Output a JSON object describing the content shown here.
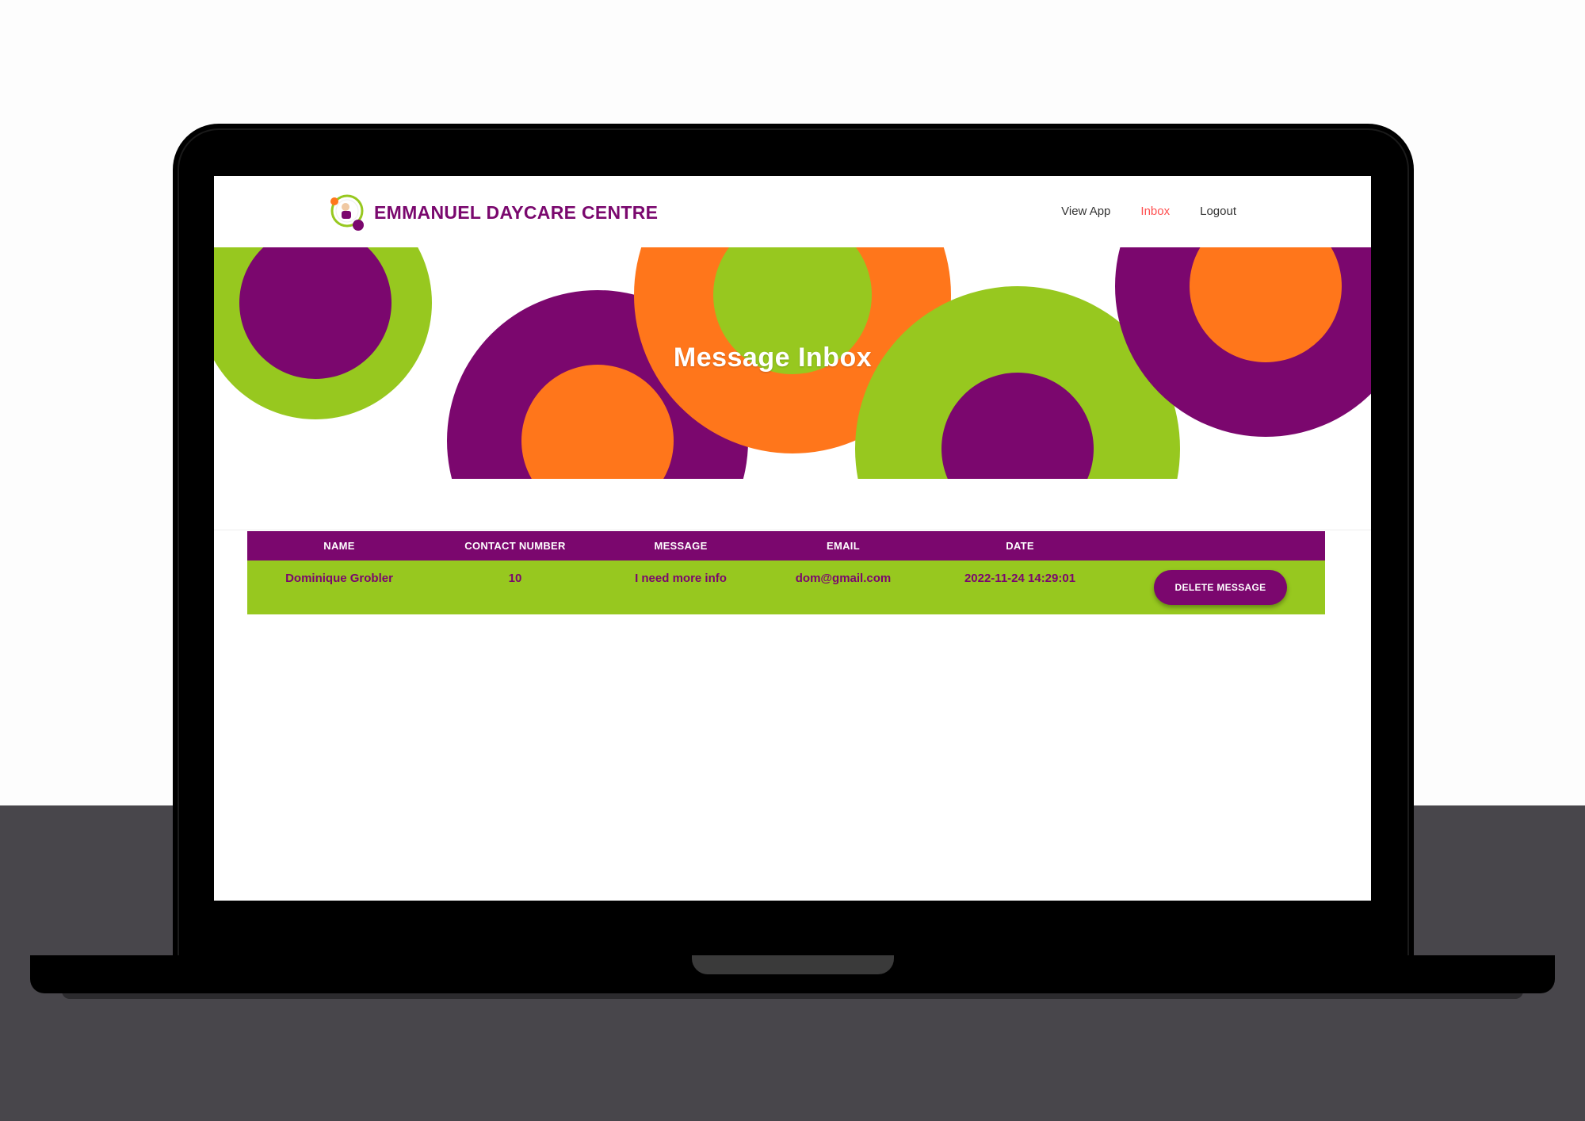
{
  "brand": {
    "name": "EMMANUEL DAYCARE CENTRE"
  },
  "nav": {
    "items": [
      "View App",
      "Inbox",
      "Logout"
    ],
    "active": "Inbox"
  },
  "hero": {
    "title": "Message Inbox"
  },
  "table": {
    "columns": [
      "NAME",
      "CONTACT NUMBER",
      "MESSAGE",
      "EMAIL",
      "DATE",
      ""
    ],
    "rows": [
      {
        "name": "Dominique Grobler",
        "contact": "10",
        "message": "I need more info",
        "email": "dom@gmail.com",
        "date": "2022-11-24 14:29:01",
        "action": "DELETE MESSAGE"
      }
    ]
  },
  "colors": {
    "purple": "#7b076e",
    "green": "#97c81f",
    "orange": "#ff761b",
    "active_link": "#ff4f4f"
  }
}
